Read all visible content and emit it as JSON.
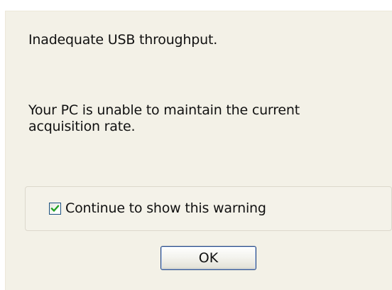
{
  "dialog": {
    "message_title": "Inadequate USB throughput.",
    "message_body": "Your PC is unable to maintain the current acquisition rate.",
    "warning_checkbox": {
      "label": "Continue to show this warning",
      "checked": true
    },
    "ok_label": "OK"
  }
}
